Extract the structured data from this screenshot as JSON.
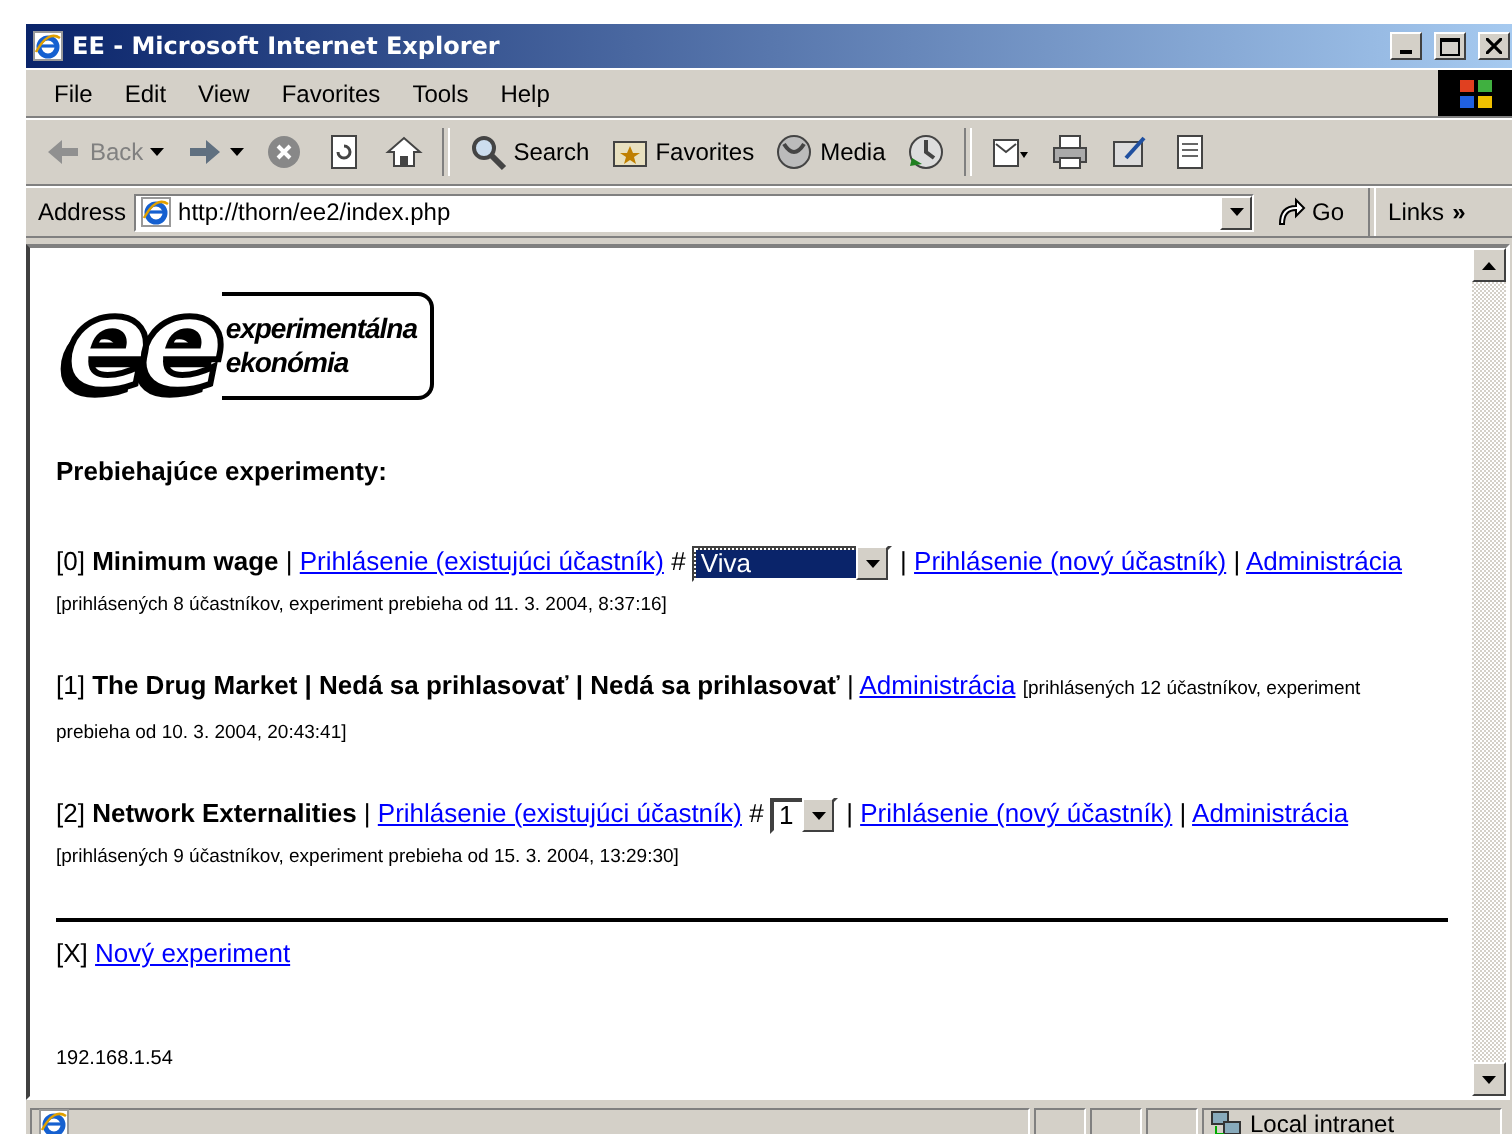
{
  "window": {
    "title": "EE - Microsoft Internet Explorer"
  },
  "menu": [
    {
      "label": "File"
    },
    {
      "label": "Edit"
    },
    {
      "label": "View"
    },
    {
      "label": "Favorites"
    },
    {
      "label": "Tools"
    },
    {
      "label": "Help"
    }
  ],
  "toolbar": [
    {
      "kind": "back",
      "label": "Back",
      "disabled": true
    },
    {
      "kind": "forward"
    },
    {
      "kind": "stop"
    },
    {
      "kind": "refresh"
    },
    {
      "kind": "home"
    },
    {
      "kind": "search",
      "label": "Search"
    },
    {
      "kind": "favorites",
      "label": "Favorites"
    },
    {
      "kind": "media",
      "label": "Media"
    },
    {
      "kind": "history"
    },
    {
      "kind": "mail"
    },
    {
      "kind": "print"
    },
    {
      "kind": "edit"
    },
    {
      "kind": "discuss"
    }
  ],
  "address": {
    "label": "Address",
    "value": "http://thorn/ee2/index.php",
    "go": "Go",
    "links": "Links",
    "more": "»"
  },
  "logo": {
    "mark": "ee",
    "line1": "experimentálna",
    "line2": "ekonómia"
  },
  "heading": "Prebiehajúce experimenty:",
  "experiments": [
    {
      "segments": [
        {
          "kind": "text",
          "text": "[0] "
        },
        {
          "kind": "bold",
          "text": "Minimum wage"
        },
        {
          "kind": "text",
          "text": " | "
        },
        {
          "kind": "link",
          "text": "Prihlásenie (existujúci účastník)"
        },
        {
          "kind": "text",
          "text": " # "
        },
        {
          "kind": "select",
          "text": "Viva",
          "highlighted": true
        },
        {
          "kind": "text",
          "text": " | "
        },
        {
          "kind": "link",
          "text": "Prihlásenie (nový účastník)"
        },
        {
          "kind": "text",
          "text": " | "
        },
        {
          "kind": "link",
          "text": "Administrácia"
        },
        {
          "kind": "small",
          "text": "[prihlásených 8 účastníkov, experiment prebieha od 11. 3. 2004, 8:37:16]"
        }
      ]
    },
    {
      "segments": [
        {
          "kind": "text",
          "text": "[1] "
        },
        {
          "kind": "bold",
          "text": "The Drug Market | Nedá sa prihlasovať | Nedá sa prihlasovať"
        },
        {
          "kind": "text",
          "text": " | "
        },
        {
          "kind": "link",
          "text": "Administrácia"
        },
        {
          "kind": "small",
          "text": "[prihlásených 12 účastníkov, experiment"
        },
        {
          "kind": "small",
          "text": "prebieha od 10. 3. 2004, 20:43:41]"
        }
      ]
    },
    {
      "segments": [
        {
          "kind": "text",
          "text": "[2] "
        },
        {
          "kind": "bold",
          "text": "Network Externalities"
        },
        {
          "kind": "text",
          "text": " | "
        },
        {
          "kind": "link",
          "text": "Prihlásenie (existujúci účastník)"
        },
        {
          "kind": "text",
          "text": " # "
        },
        {
          "kind": "select",
          "text": "1",
          "highlighted": false
        },
        {
          "kind": "text",
          "text": " | "
        },
        {
          "kind": "link",
          "text": "Prihlásenie (nový účastník)"
        },
        {
          "kind": "text",
          "text": " | "
        },
        {
          "kind": "link",
          "text": "Administrácia"
        },
        {
          "kind": "small",
          "text": "[prihlásených 9 účastníkov, experiment prebieha od 15. 3. 2004, 13:29:30]"
        }
      ]
    }
  ],
  "new_experiment": {
    "prefix": "[X]",
    "link": "Nový experiment"
  },
  "footer_ip": "192.168.1.54",
  "status_bar": {
    "zone": "Local intranet"
  }
}
